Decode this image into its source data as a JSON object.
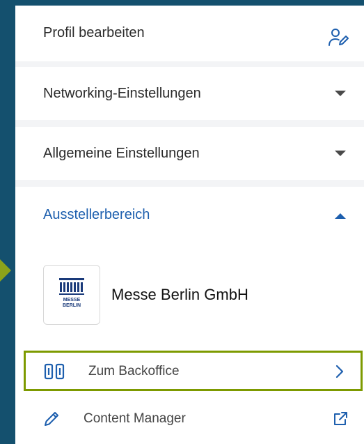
{
  "menu": {
    "profile_edit": "Profil bearbeiten",
    "networking_settings": "Networking-Einstellungen",
    "general_settings": "Allgemeine Einstellungen",
    "exhibitor_area": "Ausstellerbereich"
  },
  "exhibitor": {
    "company_name": "Messe Berlin GmbH",
    "logo_text_top": "MESSE",
    "logo_text_bottom": "BERLIN",
    "backoffice_label": "Zum Backoffice",
    "content_manager_label": "Content Manager"
  },
  "icons": {
    "profile_edit": "user-edit-icon",
    "networking_caret": "caret-down-icon",
    "general_caret": "caret-down-icon",
    "exhibitor_caret": "caret-up-icon",
    "backoffice": "columns-icon",
    "backoffice_arrow": "chevron-right-icon",
    "content_manager": "pencil-icon",
    "content_manager_external": "external-link-icon"
  },
  "colors": {
    "background": "#14506e",
    "accent_blue": "#1d5fae",
    "highlight_green": "#7d9a00",
    "arrow_green": "#8ca31a"
  }
}
